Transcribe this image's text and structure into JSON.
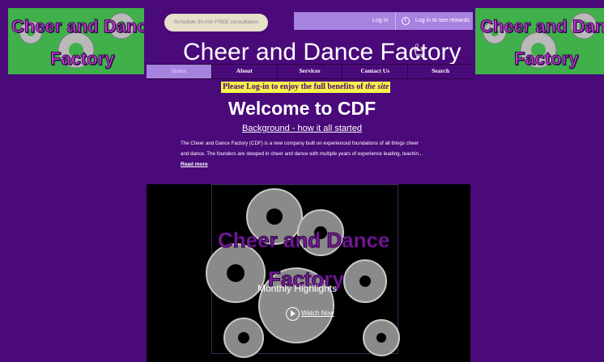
{
  "logo": {
    "line1": "Cheer and Dance",
    "line2": "Factory"
  },
  "header": {
    "consult_label": "Schedule 30-min FREE consultation",
    "login_label": "Log In",
    "rewards_label": "Log in to see rewards",
    "site_title": "Cheer and Dance Factory",
    "cart_count": "0"
  },
  "nav": {
    "items": [
      "Home",
      "About",
      "Services",
      "Contact Us",
      "Search"
    ],
    "active": "Home"
  },
  "notice": {
    "prefix": "Please Log-in to enjoy the full benefits of",
    "suffix": "the site"
  },
  "main": {
    "welcome": "Welcome to CDF",
    "background_link": "Background - how it all started",
    "paragraph_1": "The Cheer and Dance Factory (CDF) is a new company built on experienced foundations of all things cheer",
    "paragraph_2": "and dance. The founders are steeped in cheer and dance with multiple years of experience leading, teachin...",
    "read_more": "Read more"
  },
  "video": {
    "overlay_line1": "Cheer and Dance",
    "overlay_line2": "Factory",
    "highlights": "Monthly Highlights",
    "watch_now": "Watch Now"
  },
  "colors": {
    "background": "#4a0a7a",
    "accent": "#a783e0",
    "logo_green": "#3fb04a",
    "notice_yellow": "#f5f34a"
  }
}
